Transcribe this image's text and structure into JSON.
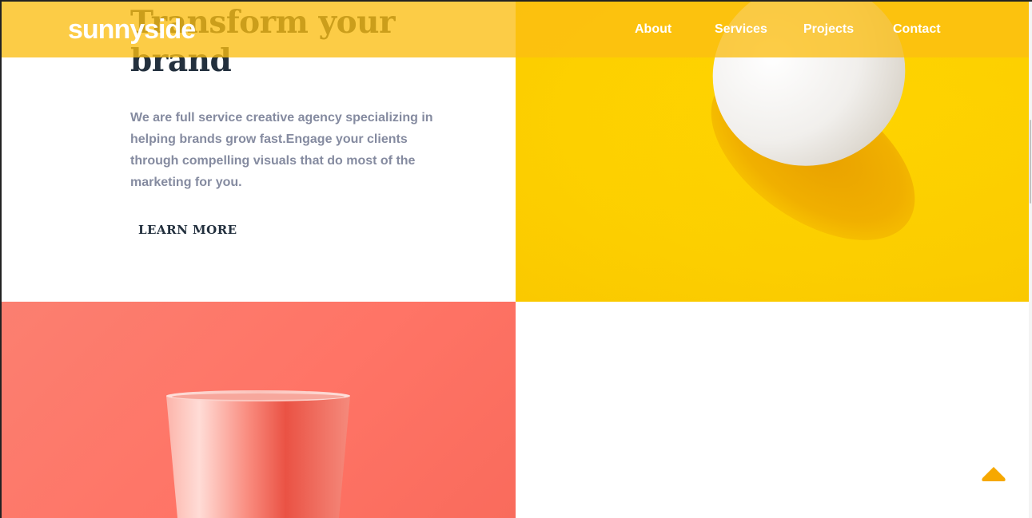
{
  "header": {
    "logo": "sunnyside",
    "nav": [
      {
        "label": "About"
      },
      {
        "label": "Services"
      },
      {
        "label": "Projects"
      },
      {
        "label": "Contact"
      }
    ]
  },
  "hero": {
    "title": "Transform your brand",
    "description": "We are full service creative agency specializing in helping brands grow fast.Engage your clients through compelling visuals that do most of the marketing for you.",
    "cta": "LEARN MORE"
  },
  "images": {
    "egg": "egg-on-yellow-image",
    "cup": "cup-on-coral-image"
  },
  "colors": {
    "header_overlay": "#fbbe12",
    "title": "#23303e",
    "body_text": "#858ba0",
    "yellow": "#fdd000",
    "coral": "#ff7466",
    "back_to_top": "#f6a800"
  },
  "icons": {
    "back_to_top": "chevron-up-icon"
  }
}
